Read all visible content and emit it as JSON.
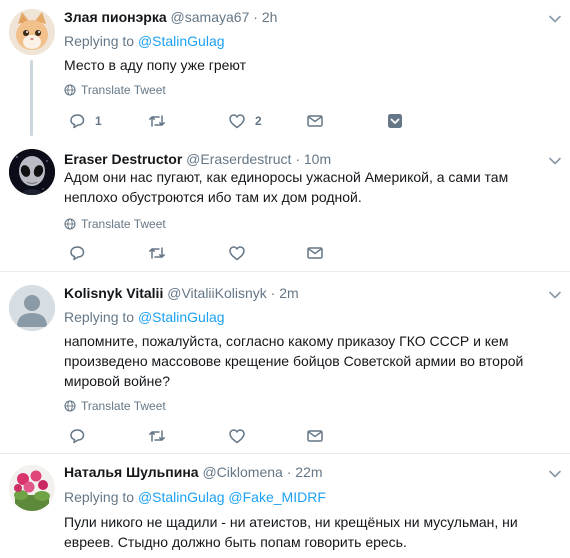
{
  "tweets": [
    {
      "name": "Злая пионэрка",
      "handle": "@samaya67",
      "dot": "·",
      "time": "2h",
      "replying_label": "Replying to",
      "replying_to": [
        "@StalinGulag"
      ],
      "text": "Место в аду попу уже греют",
      "translate": "Translate Tweet",
      "reply_count": "1",
      "retweet_count": "",
      "like_count": "2"
    },
    {
      "name": "Eraser Destructor",
      "handle": "@Eraserdestruct",
      "dot": "·",
      "time": "10m",
      "text": "Адом они нас пугают, как единоросы ужасной Америкой, а сами там неплохо обустроются ибо там их дом родной.",
      "translate": "Translate Tweet",
      "reply_count": "",
      "retweet_count": "",
      "like_count": ""
    },
    {
      "name": "Kolisnyk Vitalii",
      "handle": "@VitaliiKolisnyk",
      "dot": "·",
      "time": "2m",
      "replying_label": "Replying to",
      "replying_to": [
        "@StalinGulag"
      ],
      "text": "напомните, пожалуйста,  согласно какому приказоу ГКО СССР и кем произведено массовове крещение бойцов Советской армии во второй мировой войне?",
      "translate": "Translate Tweet",
      "reply_count": "",
      "retweet_count": "",
      "like_count": ""
    },
    {
      "name": "Наталья Шульпина",
      "handle": "@Ciklomena",
      "dot": "·",
      "time": "22m",
      "replying_label": "Replying to",
      "replying_to": [
        "@StalinGulag",
        "@Fake_MIDRF"
      ],
      "text": "Пули никого не щадили - ни атеистов, ни крещёных ни мусульман, ни евреев. Стыдно должно быть попам говорить ересь."
    }
  ],
  "colors": {
    "link": "#1da1f2",
    "secondary": "#657786",
    "divider": "#e6ecf0",
    "thread": "#ccd6dd",
    "text": "#14171a"
  },
  "icons": [
    "reply-icon",
    "retweet-icon",
    "like-icon",
    "message-icon",
    "share-icon",
    "globe-icon",
    "chevron-down-icon"
  ]
}
